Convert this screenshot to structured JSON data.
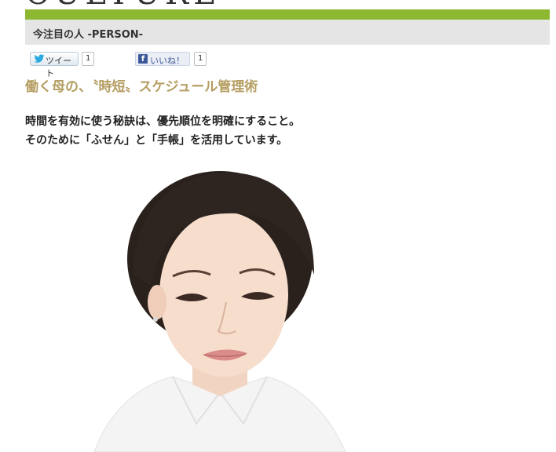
{
  "category_title": "CULTURE",
  "section": {
    "title": "今注目の人 -PERSON-"
  },
  "social": {
    "tweet_label": "ツイート",
    "tweet_count": "1",
    "like_label": "いいね！",
    "like_count": "1"
  },
  "article": {
    "title": "働く母の、〝時短〟スケジュール管理術",
    "lead_line1": "時間を有効に使う秘訣は、優先順位を明確にすること。",
    "lead_line2": "そのために「ふせん」と「手帳」を活用しています。"
  },
  "colors": {
    "accent_green": "#8cb832",
    "header_gray": "#e5e5e5",
    "title_gold": "#b59e62",
    "facebook_blue": "#3b5998"
  }
}
